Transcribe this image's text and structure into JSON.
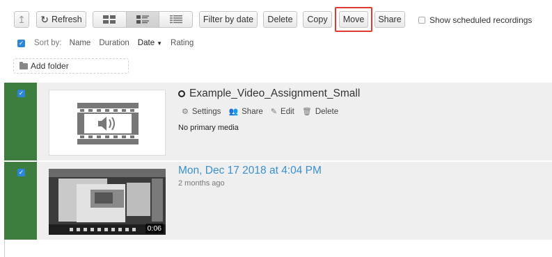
{
  "toolbar": {
    "up_glyph": "↥",
    "refresh_label": "Refresh",
    "filter_label": "Filter by date",
    "delete_label": "Delete",
    "copy_label": "Copy",
    "move_label": "Move",
    "share_label": "Share",
    "scheduled_label": "Show scheduled recordings",
    "view_modes": [
      "thumbnails",
      "detailed-list",
      "compact-list"
    ],
    "active_view": "detailed-list",
    "highlight_color": "#e03a2e"
  },
  "sortbar": {
    "label": "Sort by:",
    "options": [
      "Name",
      "Duration",
      "Date",
      "Rating"
    ],
    "active": "Date"
  },
  "add_folder_label": "Add folder",
  "sessions": [
    {
      "title": "Example_Video_Assignment_Small",
      "actions": [
        "Settings",
        "Share",
        "Edit",
        "Delete"
      ],
      "note": "No primary media",
      "checked": true
    },
    {
      "title": "Mon, Dec 17 2018 at 4:04 PM",
      "age": "2 months ago",
      "duration": "0:06",
      "checked": true
    }
  ],
  "colors": {
    "selected_bar": "#3d7d3f",
    "checkbox": "#2b86d9",
    "link": "#3a8fd0",
    "row_bg": "#efefef"
  }
}
